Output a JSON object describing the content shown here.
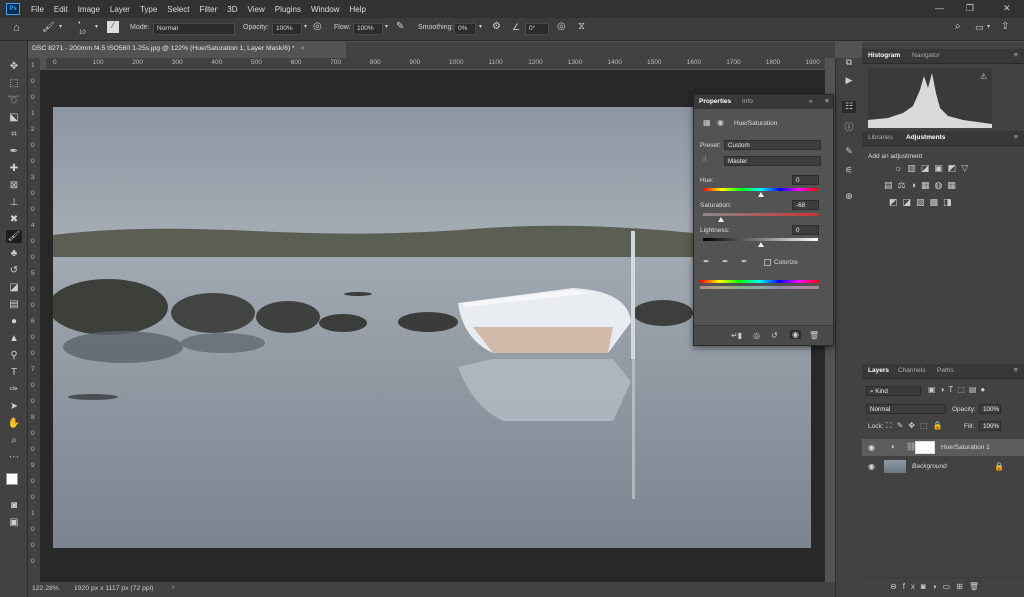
{
  "app": {
    "logo": "Ps"
  },
  "menu": [
    "File",
    "Edit",
    "Image",
    "Layer",
    "Type",
    "Select",
    "Filter",
    "3D",
    "View",
    "Plugins",
    "Window",
    "Help"
  ],
  "options": {
    "brush_size": "10",
    "mode_label": "Mode:",
    "mode_value": "Normal",
    "opacity_label": "Opacity:",
    "opacity_value": "100%",
    "flow_label": "Flow:",
    "flow_value": "100%",
    "smoothing_label": "Smoothing:",
    "smoothing_value": "0%",
    "angle_value": "0°"
  },
  "document": {
    "tab_title": "DSC 8271 - 200mm f4.5 ISO560 1-25s.jpg @ 122% (Hue/Saturation 1, Layer Mask/8) *"
  },
  "ruler": {
    "h": [
      "0",
      "100",
      "200",
      "300",
      "400",
      "500",
      "600",
      "700",
      "800",
      "900",
      "1000",
      "1100",
      "1200",
      "1300",
      "1400",
      "1500",
      "1600",
      "1700",
      "1800",
      "1900"
    ],
    "v": [
      "1",
      "0",
      "0",
      "1",
      "2",
      "0",
      "0",
      "3",
      "0",
      "0",
      "4",
      "0",
      "0",
      "5",
      "0",
      "0",
      "6",
      "0",
      "0",
      "7",
      "0",
      "0",
      "8",
      "0",
      "0",
      "9",
      "0",
      "0",
      "1",
      "0",
      "0",
      "0"
    ]
  },
  "status": {
    "zoom": "122.28%",
    "doc_info": "1920 px x 1117 px (72 ppi)"
  },
  "properties": {
    "tabs": [
      "Properties",
      "Info"
    ],
    "adjustment_title": "Hue/Saturation",
    "preset_label": "Preset:",
    "preset_value": "Custom",
    "channel_value": "Master",
    "hue_label": "Hue:",
    "hue_value": "0",
    "hue_level": 0.5,
    "saturation_label": "Saturation:",
    "saturation_value": "-68",
    "saturation_level": 0.16,
    "lightness_label": "Lightness:",
    "lightness_value": "0",
    "lightness_level": 0.5,
    "colorize_label": "Colorize"
  },
  "histogram": {
    "tabs": [
      "Histogram",
      "Navigator"
    ]
  },
  "adjustments": {
    "tabs": [
      "Libraries",
      "Adjustments"
    ],
    "add_label": "Add an adjustment"
  },
  "layers": {
    "tabs": [
      "Layers",
      "Channels",
      "Paths"
    ],
    "kind_value": "Kind",
    "blend_value": "Normal",
    "opacity_label": "Opacity:",
    "opacity_value": "100%",
    "lock_label": "Lock:",
    "fill_label": "Fill:",
    "fill_value": "100%",
    "items": [
      {
        "name": "Hue/Saturation 1"
      },
      {
        "name": "Background"
      }
    ]
  }
}
